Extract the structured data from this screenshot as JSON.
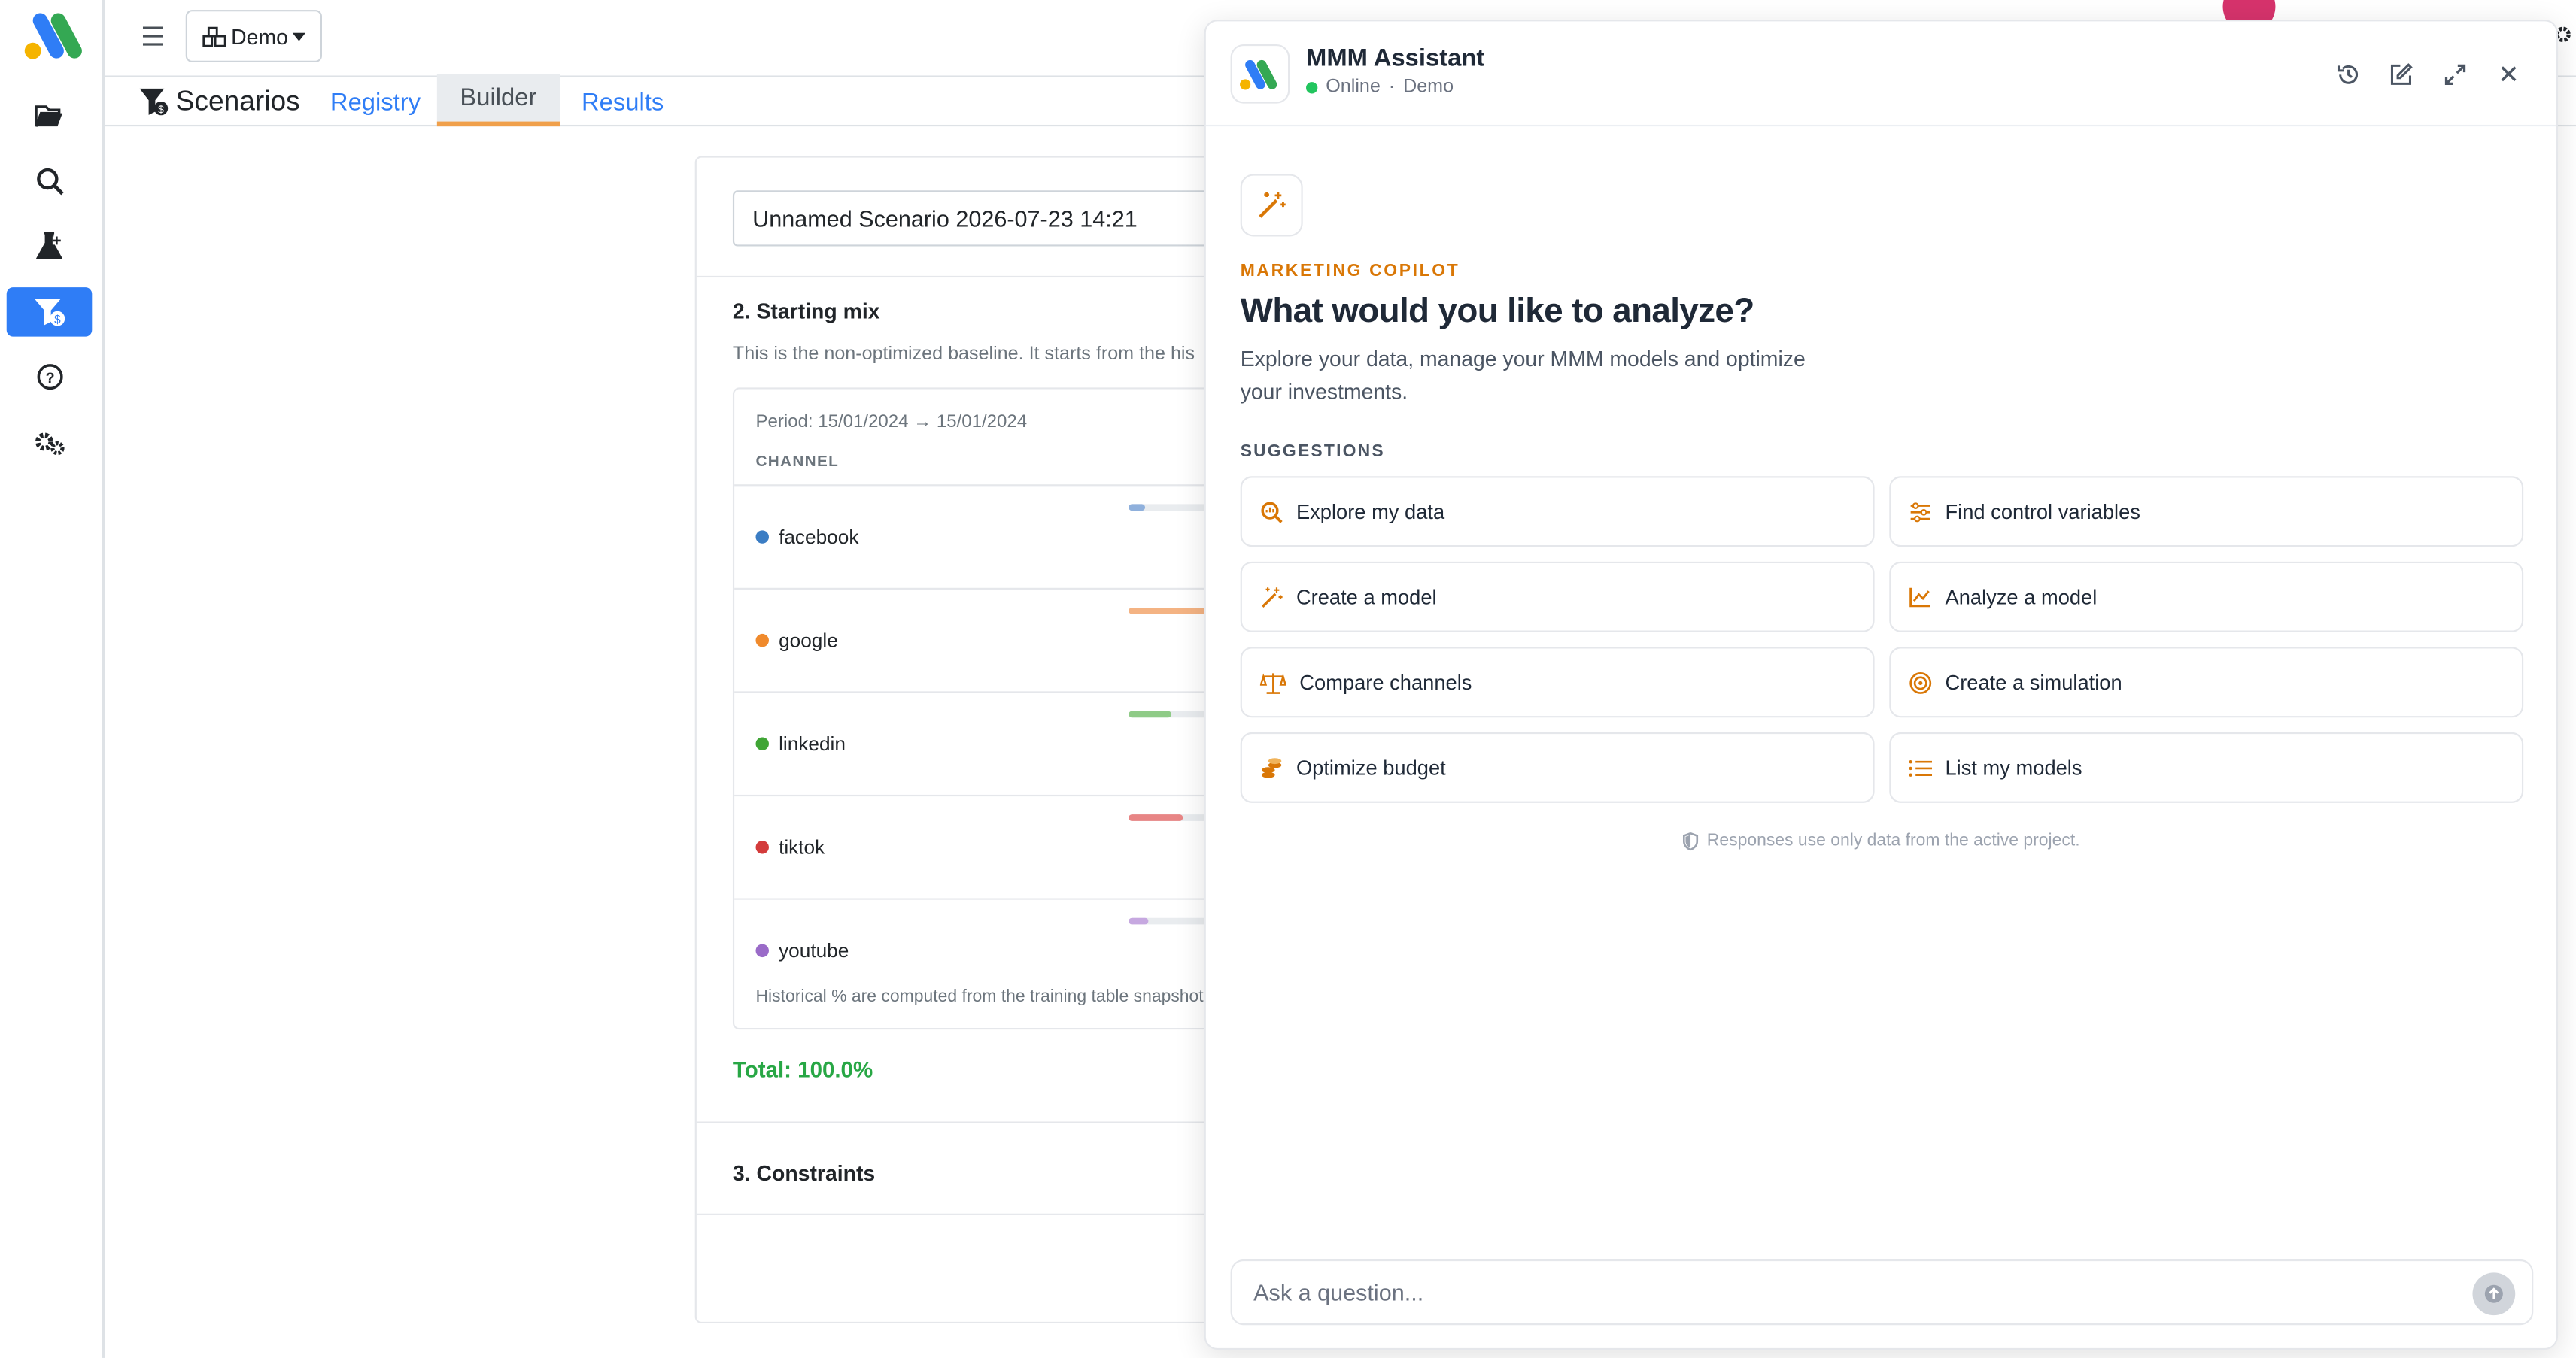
{
  "project": {
    "label": "Demo"
  },
  "tabs": {
    "title": "Scenarios",
    "registry": "Registry",
    "builder": "Builder",
    "results": "Results"
  },
  "scenario": {
    "name": "Unnamed Scenario 2026-07-23 14:21",
    "section2_title": "2. Starting mix",
    "section2_desc": "This is the non-optimized baseline. It starts from the his",
    "period": "Period: 15/01/2024 → 15/01/2024",
    "channel_header": "CHANNEL",
    "channels": [
      {
        "name": "facebook",
        "color": "#3b7dc4",
        "bar_color": "#8fb0dc",
        "share": 0.17
      },
      {
        "name": "google",
        "color": "#f08a2c",
        "bar_color": "#f4b383",
        "share": 0.8
      },
      {
        "name": "linkedin",
        "color": "#3fa535",
        "bar_color": "#8fcb87",
        "share": 0.43
      },
      {
        "name": "tiktok",
        "color": "#d33b3b",
        "bar_color": "#e88585",
        "share": 0.55
      },
      {
        "name": "youtube",
        "color": "#9a6bc8",
        "bar_color": "#c6a8e0",
        "share": 0.2
      }
    ],
    "footnote": "Historical % are computed from the training table snapshot",
    "total": "Total: 100.0%",
    "section3_title": "3. Constraints"
  },
  "assistant": {
    "title": "MMM Assistant",
    "status": "Online",
    "project": "Demo",
    "kicker": "MARKETING COPILOT",
    "heading": "What would you like to analyze?",
    "subtitle": "Explore your data, manage your MMM models and optimize your investments.",
    "suggestions_label": "SUGGESTIONS",
    "suggestions": [
      {
        "label": "Explore my data",
        "icon": "search-data-icon"
      },
      {
        "label": "Find control variables",
        "icon": "sliders-icon"
      },
      {
        "label": "Create a model",
        "icon": "magic-wand-icon"
      },
      {
        "label": "Analyze a model",
        "icon": "line-chart-icon"
      },
      {
        "label": "Compare channels",
        "icon": "balance-scale-icon"
      },
      {
        "label": "Create a simulation",
        "icon": "target-icon"
      },
      {
        "label": "Optimize budget",
        "icon": "coins-icon"
      },
      {
        "label": "List my models",
        "icon": "list-icon"
      }
    ],
    "note": "Responses use only data from the active project.",
    "input_placeholder": "Ask a question..."
  },
  "colors": {
    "accent": "#2f7df6",
    "copilot": "#d97706",
    "success": "#28a745"
  }
}
